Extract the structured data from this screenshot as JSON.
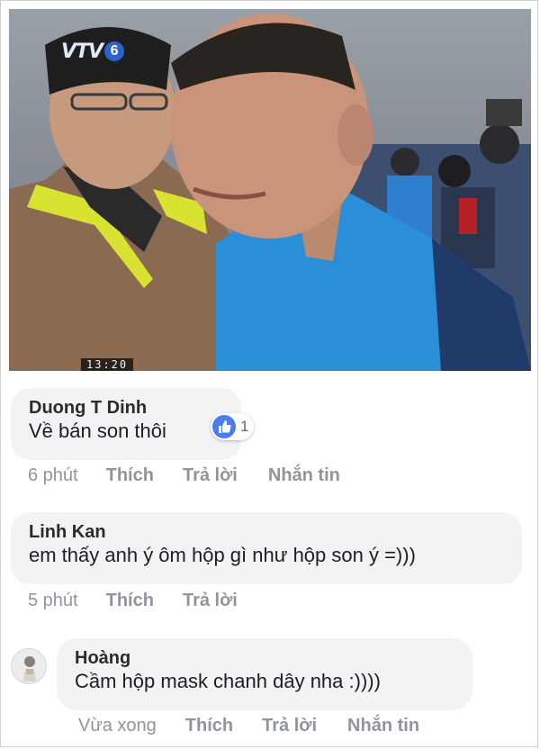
{
  "tv_still": {
    "channel_logo": "VTV6",
    "channel_logo_text": "VTV",
    "channel_logo_number": "6",
    "clock": "13:20"
  },
  "comments": [
    {
      "author": "Duong T Dinh",
      "text": "Về bán son thôi",
      "reaction_icon": "thumbs-up-icon",
      "reaction_count": "1",
      "timestamp": "6 phút",
      "like_label": "Thích",
      "reply_label": "Trả lời",
      "message_label": "Nhắn tin"
    },
    {
      "author": "Linh Kan",
      "text": "em thấy anh ý ôm hộp gì như hộp son ý =)))",
      "timestamp": "5 phút",
      "like_label": "Thích",
      "reply_label": "Trả lời"
    },
    {
      "author": "Hoàng",
      "text": "Cầm hộp mask chanh dây nha :))))",
      "avatar_icon": "profile-photo-icon",
      "timestamp": "Vừa xong",
      "like_label": "Thích",
      "reply_label": "Trả lời",
      "message_label": "Nhắn tin"
    }
  ],
  "colors": {
    "bubble": "#f2f3f5",
    "action_text": "#90949c",
    "like_blue": "#4a7bf0"
  }
}
